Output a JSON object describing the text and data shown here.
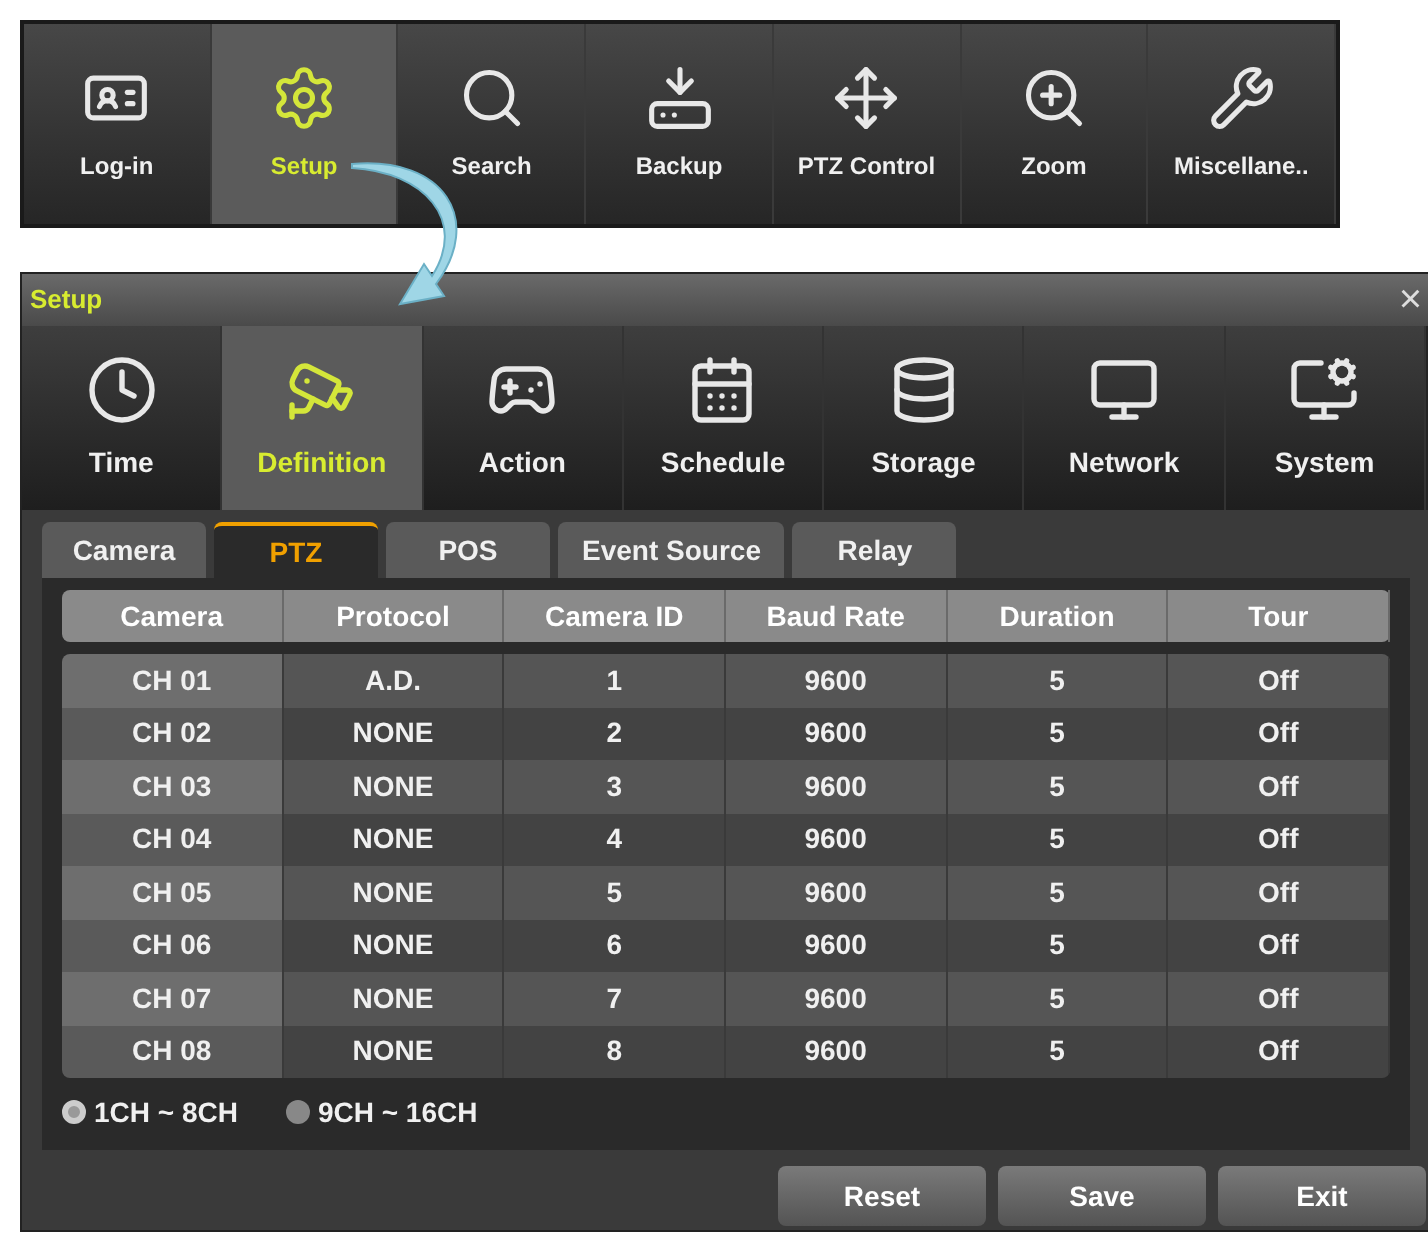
{
  "toolbar": [
    {
      "label": "Log-in",
      "selected": false
    },
    {
      "label": "Setup",
      "selected": true
    },
    {
      "label": "Search",
      "selected": false
    },
    {
      "label": "Backup",
      "selected": false
    },
    {
      "label": "PTZ Control",
      "selected": false
    },
    {
      "label": "Zoom",
      "selected": false
    },
    {
      "label": "Miscellane..",
      "selected": false
    }
  ],
  "window": {
    "title": "Setup",
    "close": "×"
  },
  "categories": [
    {
      "label": "Time",
      "selected": false
    },
    {
      "label": "Definition",
      "selected": true
    },
    {
      "label": "Action",
      "selected": false
    },
    {
      "label": "Schedule",
      "selected": false
    },
    {
      "label": "Storage",
      "selected": false
    },
    {
      "label": "Network",
      "selected": false
    },
    {
      "label": "System",
      "selected": false
    }
  ],
  "tabs": [
    {
      "label": "Camera",
      "selected": false
    },
    {
      "label": "PTZ",
      "selected": true
    },
    {
      "label": "POS",
      "selected": false
    },
    {
      "label": "Event Source",
      "selected": false
    },
    {
      "label": "Relay",
      "selected": false
    }
  ],
  "table": {
    "columns": [
      "Camera",
      "Protocol",
      "Camera ID",
      "Baud Rate",
      "Duration",
      "Tour"
    ],
    "rows": [
      [
        "CH 01",
        "A.D.",
        "1",
        "9600",
        "5",
        "Off"
      ],
      [
        "CH 02",
        "NONE",
        "2",
        "9600",
        "5",
        "Off"
      ],
      [
        "CH 03",
        "NONE",
        "3",
        "9600",
        "5",
        "Off"
      ],
      [
        "CH 04",
        "NONE",
        "4",
        "9600",
        "5",
        "Off"
      ],
      [
        "CH 05",
        "NONE",
        "5",
        "9600",
        "5",
        "Off"
      ],
      [
        "CH 06",
        "NONE",
        "6",
        "9600",
        "5",
        "Off"
      ],
      [
        "CH 07",
        "NONE",
        "7",
        "9600",
        "5",
        "Off"
      ],
      [
        "CH 08",
        "NONE",
        "8",
        "9600",
        "5",
        "Off"
      ]
    ]
  },
  "channel_ranges": [
    {
      "label": "1CH ~ 8CH",
      "selected": true
    },
    {
      "label": "9CH ~ 16CH",
      "selected": false
    }
  ],
  "buttons": [
    "Reset",
    "Save",
    "Exit"
  ]
}
